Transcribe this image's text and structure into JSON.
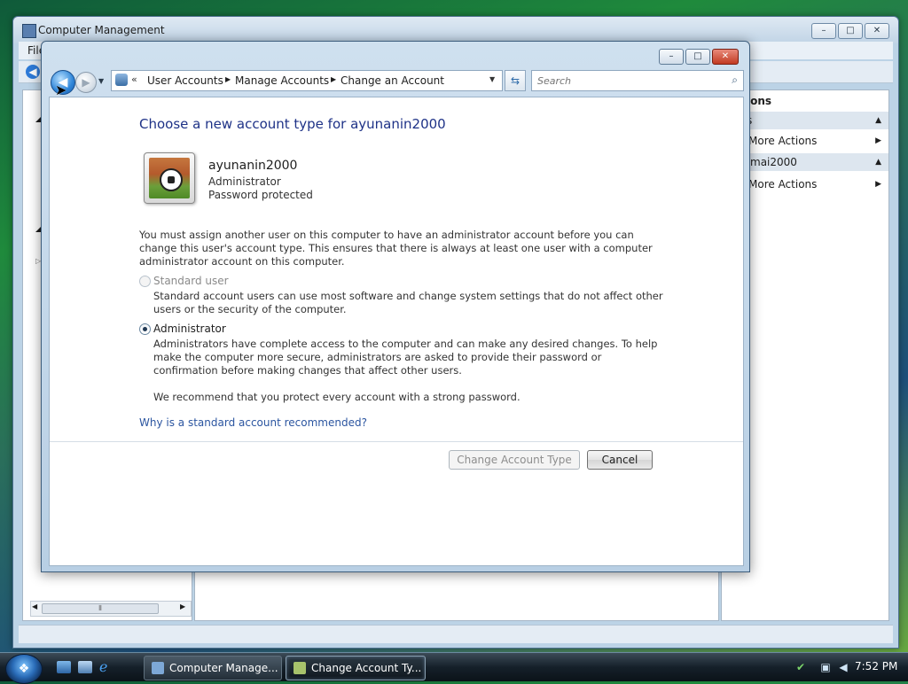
{
  "background_window": {
    "title": "Computer Management",
    "menu_file": "File",
    "actions_pane": {
      "header_partial": "ions",
      "section1_partial": "s",
      "more_actions_1": "More Actions",
      "section2_partial": "mai2000",
      "more_actions_2": "More Actions"
    },
    "caption": {
      "minimize": "–",
      "maximize": "□",
      "close": "✕"
    }
  },
  "dialog": {
    "caption": {
      "minimize": "–",
      "maximize": "□",
      "close": "✕"
    },
    "breadcrumb": {
      "chevron": "«",
      "items": [
        "User Accounts",
        "Manage Accounts",
        "Change an Account"
      ],
      "separator": "▶"
    },
    "search": {
      "placeholder": "Search"
    },
    "heading": "Choose a new account type for ayunanin2000",
    "account": {
      "name": "ayunanin2000",
      "type": "Administrator",
      "password_status": "Password protected"
    },
    "warning": "You must assign another user on this computer to have an administrator account before you can change this user's account type. This ensures that there is always at least one user with a computer administrator account on this computer.",
    "options": {
      "standard": {
        "label": "Standard user",
        "description": "Standard account users can use most software and change system settings that do not affect other users or the security of the computer.",
        "selected": false,
        "enabled": false
      },
      "administrator": {
        "label": "Administrator",
        "description": "Administrators have complete access to the computer and can make any desired changes. To help make the computer more secure, administrators are asked to provide their password or confirmation before making changes that affect other users.",
        "recommendation": "We recommend that you protect every account with a strong password.",
        "selected": true,
        "enabled": true
      }
    },
    "help_link": "Why is a standard account recommended?",
    "buttons": {
      "change": "Change Account Type",
      "cancel": "Cancel"
    }
  },
  "taskbar": {
    "tasks": [
      {
        "label": "Computer Manage..."
      },
      {
        "label": "Change Account Ty..."
      }
    ],
    "clock": "7:52 PM"
  },
  "colors": {
    "heading": "#1e3287",
    "link": "#2b55a0",
    "disabled_text": "#8a8a8a"
  }
}
